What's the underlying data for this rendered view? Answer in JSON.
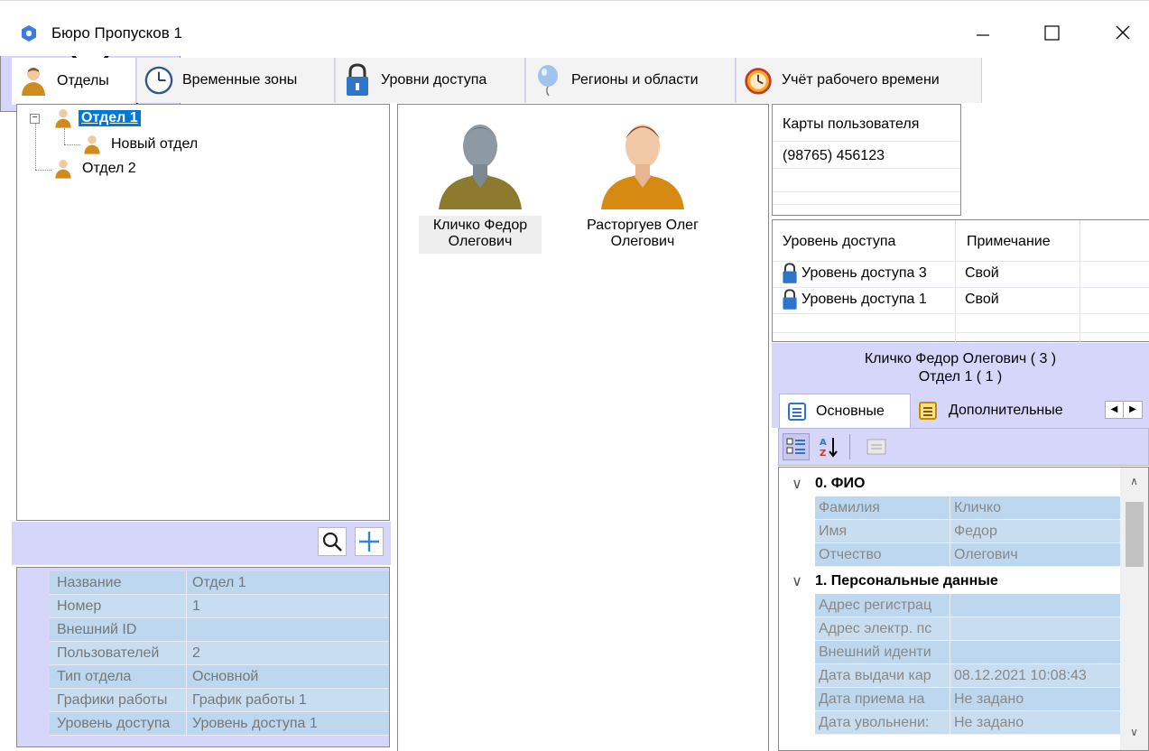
{
  "window": {
    "title": "Бюро Пропусков 1"
  },
  "tabs": [
    {
      "label": "Отделы",
      "icon": "person-icon"
    },
    {
      "label": "Временные зоны",
      "icon": "clock-icon"
    },
    {
      "label": "Уровни доступа",
      "icon": "padlock-icon"
    },
    {
      "label": "Регионы и области",
      "icon": "balloon-icon"
    },
    {
      "label": "Учёт рабочего времени",
      "icon": "alarm-clock-icon"
    }
  ],
  "tree": {
    "root": "Отдел 1",
    "child": "Новый отдел",
    "sibling": "Отдел 2"
  },
  "department_props": [
    {
      "key": "Название",
      "value": "Отдел 1"
    },
    {
      "key": "Номер",
      "value": "1"
    },
    {
      "key": "Внешний ID",
      "value": ""
    },
    {
      "key": "Пользователей",
      "value": "2"
    },
    {
      "key": "Тип отдела",
      "value": "Основной"
    },
    {
      "key": "Графики работы",
      "value": "График работы 1"
    },
    {
      "key": "Уровень доступа",
      "value": "Уровень доступа 1"
    }
  ],
  "users": [
    {
      "name_line1": "Кличко Федор",
      "name_line2": "Олегович"
    },
    {
      "name_line1": "Расторгуев Олег",
      "name_line2": "Олегович"
    }
  ],
  "cards": {
    "header": "Карты пользователя",
    "items": [
      "(98765) 456123"
    ]
  },
  "access": {
    "col1": "Уровень доступа",
    "col2": "Примечание",
    "rows": [
      {
        "level": "Уровень доступа 3",
        "note": "Свой"
      },
      {
        "level": "Уровень доступа 1",
        "note": "Свой"
      }
    ]
  },
  "info": {
    "line1": "Кличко Федор Олегович ( 3 )",
    "line2": "Отдел 1 ( 1 )"
  },
  "subtabs": {
    "main": "Основные",
    "extra": "Дополнительные"
  },
  "user_props": {
    "cat1": "0. ФИО",
    "fio": [
      {
        "key": "Фамилия",
        "value": "Кличко"
      },
      {
        "key": "Имя",
        "value": "Федор"
      },
      {
        "key": "Отчество",
        "value": "Олегович"
      }
    ],
    "cat2": "1. Персональные данные",
    "personal": [
      {
        "key": "Адрес регистрац",
        "value": ""
      },
      {
        "key": "Адрес электр. пс",
        "value": ""
      },
      {
        "key": "Внешний иденти",
        "value": ""
      },
      {
        "key": "Дата выдачи кар",
        "value": "08.12.2021 10:08:43"
      },
      {
        "key": "Дата приема на",
        "value": "Не задано"
      },
      {
        "key": "Дата увольнени:",
        "value": "Не задано"
      }
    ]
  },
  "colors": {
    "lavender": "#d6d6fa",
    "selection": "#0078d7",
    "grid_cell": "#bdd7ee"
  }
}
